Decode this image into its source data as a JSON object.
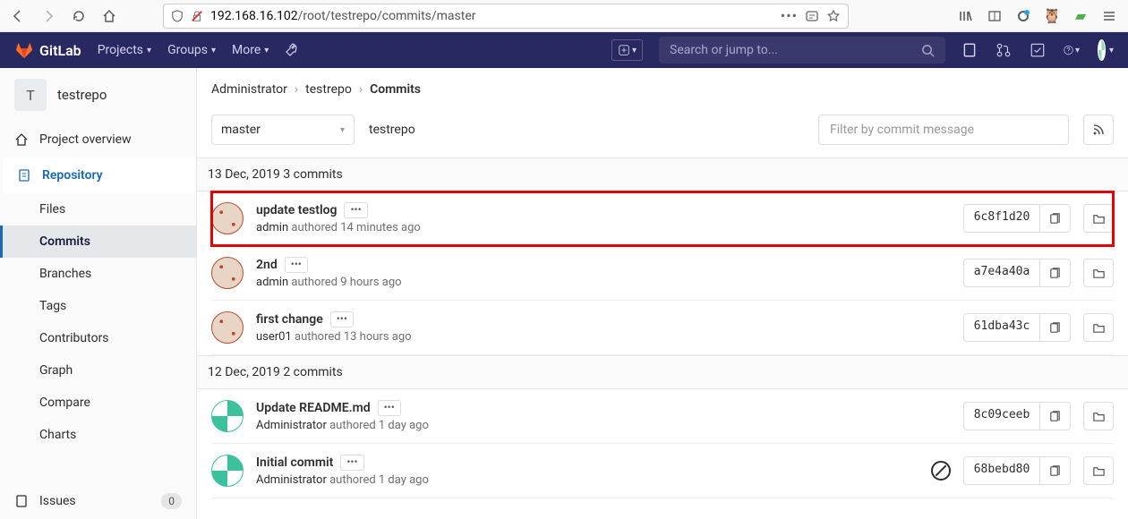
{
  "browser": {
    "url_ip": "192.168.16.102",
    "url_path": "/root/testrepo/commits/master"
  },
  "nav": {
    "brand": "GitLab",
    "menu": [
      "Projects",
      "Groups",
      "More"
    ],
    "search_placeholder": "Search or jump to..."
  },
  "sidebar": {
    "project_letter": "T",
    "project_name": "testrepo",
    "overview": "Project overview",
    "repository": "Repository",
    "subs": [
      "Files",
      "Commits",
      "Branches",
      "Tags",
      "Contributors",
      "Graph",
      "Compare",
      "Charts"
    ],
    "active_sub": "Commits",
    "issues": "Issues",
    "issues_count": "0"
  },
  "breadcrumb": {
    "items": [
      "Administrator",
      "testrepo"
    ],
    "current": "Commits"
  },
  "filters": {
    "branch": "master",
    "repo": "testrepo",
    "filter_placeholder": "Filter by commit message"
  },
  "groups": [
    {
      "date": "13 Dec, 2019",
      "count_label": "3 commits",
      "commits": [
        {
          "title": "update testlog",
          "author": "admin",
          "time": "14 minutes ago",
          "hash": "6c8f1d20",
          "avatar": "red",
          "highlighted": true
        },
        {
          "title": "2nd",
          "author": "admin",
          "time": "9 hours ago",
          "hash": "a7e4a40a",
          "avatar": "red"
        },
        {
          "title": "first change",
          "author": "user01",
          "time": "13 hours ago",
          "hash": "61dba43c",
          "avatar": "red"
        }
      ]
    },
    {
      "date": "12 Dec, 2019",
      "count_label": "2 commits",
      "commits": [
        {
          "title": "Update README.md",
          "author": "Administrator",
          "time": "1 day ago",
          "hash": "8c09ceeb",
          "avatar": "teal"
        },
        {
          "title": "Initial commit",
          "author": "Administrator",
          "time": "1 day ago",
          "hash": "68bebd80",
          "avatar": "teal",
          "ci": true
        }
      ]
    }
  ]
}
